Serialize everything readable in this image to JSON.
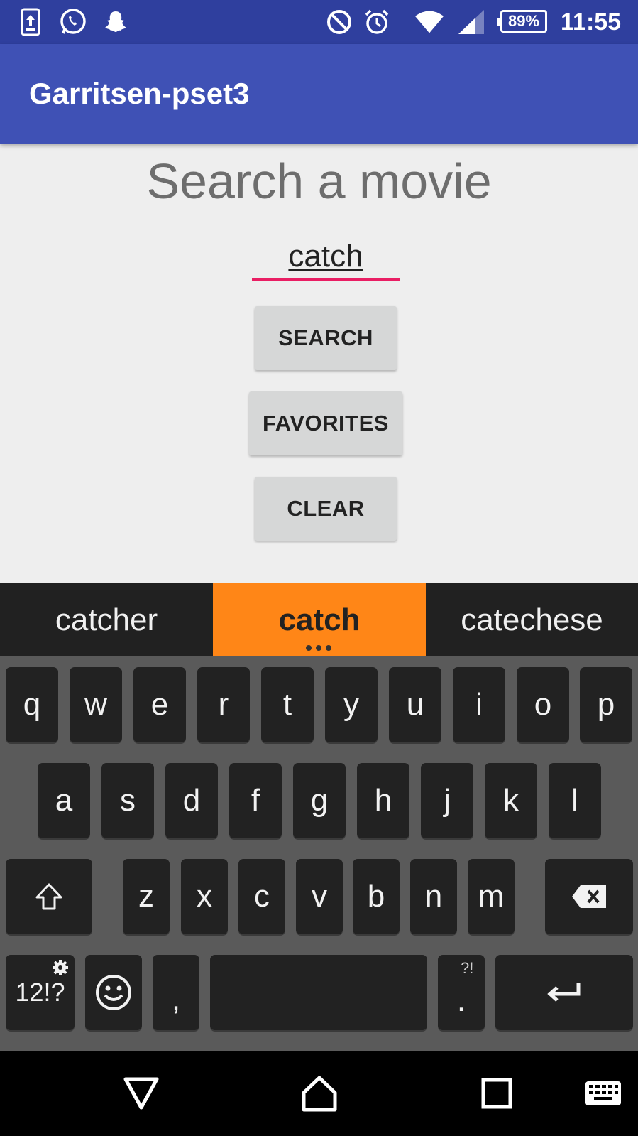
{
  "status_bar": {
    "icons": [
      "upload-icon",
      "whatsapp-icon",
      "snapchat-icon",
      "do-not-disturb-icon",
      "alarm-icon",
      "wifi-icon",
      "signal-icon"
    ],
    "battery": "89%",
    "time": "11:55"
  },
  "app_bar": {
    "title": "Garritsen-pset3"
  },
  "main": {
    "heading": "Search a movie",
    "search_value": "catch",
    "buttons": {
      "search": "SEARCH",
      "favorites": "FAVORITES",
      "clear": "CLEAR"
    }
  },
  "keyboard": {
    "suggestions": [
      "catcher",
      "catch",
      "catechese"
    ],
    "rows": [
      [
        "q",
        "w",
        "e",
        "r",
        "t",
        "y",
        "u",
        "i",
        "o",
        "p"
      ],
      [
        "a",
        "s",
        "d",
        "f",
        "g",
        "h",
        "j",
        "k",
        "l"
      ],
      [
        "z",
        "x",
        "c",
        "v",
        "b",
        "n",
        "m"
      ]
    ],
    "symbols_key": "12!?",
    "comma_key": ",",
    "period_key": ".",
    "period_sub": "?!"
  },
  "colors": {
    "status_bar": "#2f3f9e",
    "app_bar": "#3f51b5",
    "accent": "#e91e63",
    "suggestion_highlight": "#ff8617"
  }
}
